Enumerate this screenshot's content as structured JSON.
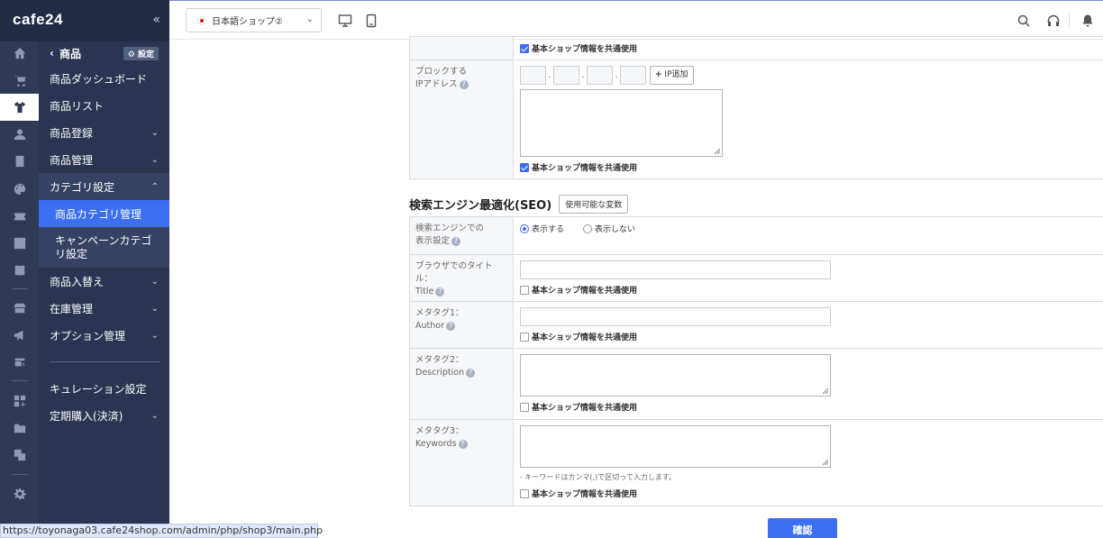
{
  "app": {
    "logo": "cafe24",
    "collapse_icon": "«"
  },
  "topbar": {
    "shop_name": "日本語ショップ②"
  },
  "subnav": {
    "header": "商品",
    "settings": "設定",
    "items": [
      {
        "label": "商品ダッシュボード"
      },
      {
        "label": "商品リスト"
      },
      {
        "label": "商品登録"
      },
      {
        "label": "商品管理"
      },
      {
        "label": "カテゴリ設定"
      },
      {
        "label": "商品入替え"
      },
      {
        "label": "在庫管理"
      },
      {
        "label": "オプション管理"
      },
      {
        "label": "キュレーション設定"
      },
      {
        "label": "定期購入(決済)"
      }
    ],
    "category_sub": [
      {
        "label": "商品カテゴリ管理"
      },
      {
        "label": "キャンペーンカテゴリ設定"
      }
    ]
  },
  "form": {
    "shared_label": "基本ショップ情報を共通使用",
    "block_ip": {
      "label_line1": "ブロックする",
      "label_line2": "IPアドレス",
      "add_button": "IP追加",
      "separator": "."
    },
    "seo": {
      "title": "検索エンジン最適化(SEO)",
      "variables_button": "使用可能な変数",
      "visibility": {
        "label_line1": "検索エンジンでの",
        "label_line2": "表示設定",
        "option_show": "表示する",
        "option_hide": "表示しない"
      },
      "browser_title": {
        "label_line1": "ブラウザでのタイトル：",
        "label_line2": "Title"
      },
      "meta1": {
        "label_line1": "メタタグ1：",
        "label_line2": "Author"
      },
      "meta2": {
        "label_line1": "メタタグ2：",
        "label_line2": "Description"
      },
      "meta3": {
        "label_line1": "メタタグ3：",
        "label_line2": "Keywords",
        "note": "- キーワードはカンマ(,)で区切って入力します。"
      }
    },
    "confirm": "確認"
  },
  "status_bar": {
    "url": "https://toyonaga03.cafe24shop.com/admin/php/shop3/main.php"
  }
}
